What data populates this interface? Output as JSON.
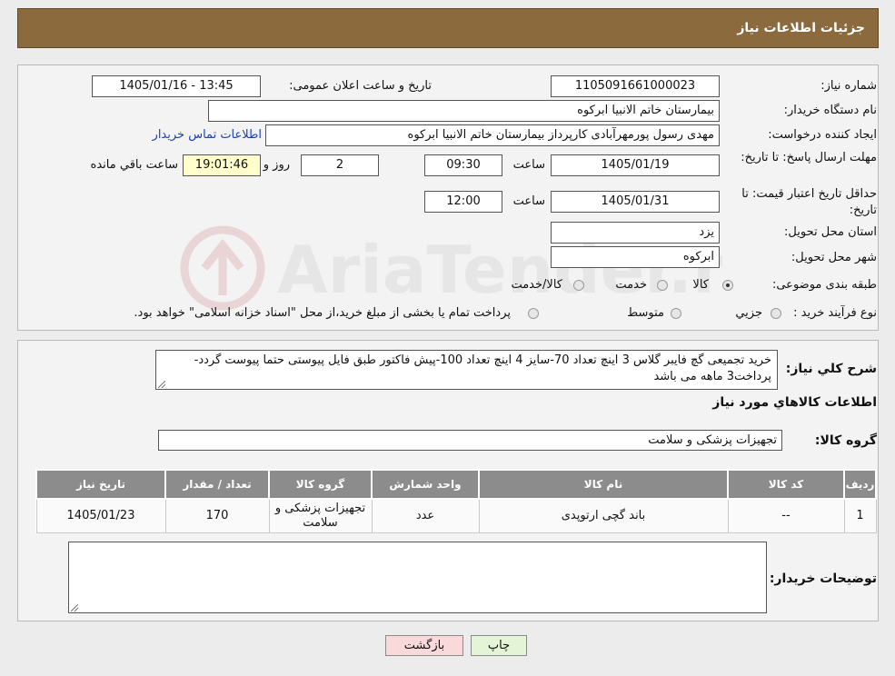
{
  "header": {
    "title": "جزئیات اطلاعات نیاز"
  },
  "details": {
    "need_number_label": "شماره نیاز:",
    "need_number": "1105091661000023",
    "announce_label": "تاریخ و ساعت اعلان عمومی:",
    "announce_value": "1405/01/16 - 13:45",
    "buyer_org_label": "نام دستگاه خریدار:",
    "buyer_org": "بیمارستان خاتم الانبیا ابرکوه",
    "creator_label": "ایجاد کننده درخواست:",
    "creator": "مهدی رسول پورمهرآبادی کارپرداز بیمارستان خاتم الانبیا ابرکوه",
    "contact_link": "اطلاعات تماس خریدار",
    "reply_deadline_label": "مهلت ارسال پاسخ: تا تاریخ:",
    "reply_date": "1405/01/19",
    "time_label": "ساعت",
    "reply_time": "09:30",
    "days_value": "2",
    "days_label": "روز و",
    "remaining_time": "19:01:46",
    "remaining_label": "ساعت باقي مانده",
    "validity_label": "حداقل تاریخ اعتبار قیمت: تا تاریخ:",
    "validity_date": "1405/01/31",
    "validity_time": "12:00",
    "province_label": "استان محل تحویل:",
    "province": "یزد",
    "city_label": "شهر محل تحویل:",
    "city": "ابرکوه",
    "category_label": "طبقه بندی موضوعی:",
    "category_options": [
      "کالا",
      "خدمت",
      "کالا/خدمت"
    ],
    "category_selected": 0,
    "process_label": "نوع فرآیند خرید :",
    "process_options": [
      "جزیي",
      "متوسط"
    ],
    "process_note": "پرداخت تمام یا بخشی از مبلغ خرید،از محل \"اسناد خزانه اسلامی\" خواهد بود."
  },
  "description": {
    "label": "شرح کلي نياز:",
    "text": "خرید تجمیعی گچ فایبر گلاس 3 اینچ تعداد 70-سایز 4 اینچ تعداد 100-پیش فاکتور طبق فایل پیوستی حتما پیوست گردد-پرداخت3 ماهه می باشد"
  },
  "goods": {
    "section_title": "اطلاعات کالاهاي مورد نياز",
    "group_label": "گروه کالا:",
    "group_value": "تجهیزات پزشکی و سلامت",
    "table": {
      "headers": [
        "رديف",
        "کد کالا",
        "نام کالا",
        "واحد شمارش",
        "گروه کالا",
        "تعداد / مقدار",
        "تاريخ نياز"
      ],
      "rows": [
        [
          "1",
          "--",
          "باند گچی ارتوپدی",
          "عدد",
          "تجهیزات پزشکی و سلامت",
          "170",
          "1405/01/23"
        ]
      ]
    }
  },
  "buyer_notes": {
    "label": "توضیحات خریدار:",
    "text": ""
  },
  "buttons": {
    "print": "چاپ",
    "back": "بازگشت"
  },
  "watermark": {
    "text": "AriaTender.neT"
  },
  "colors": {
    "header_bg": "#8b6a3e",
    "link": "#1a3fb8",
    "table_header": "#8c8c8c",
    "back_btn": "#f9d9d9",
    "print_btn": "#e3f5d6"
  }
}
